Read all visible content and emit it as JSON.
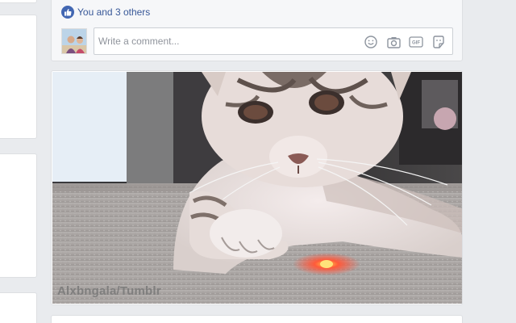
{
  "post": {
    "likes_text": "You and 3 others",
    "like_icon": "thumbs-up-icon"
  },
  "comment": {
    "placeholder": "Write a comment...",
    "icons": [
      "emoji-icon",
      "camera-icon",
      "gif-icon",
      "sticker-icon"
    ],
    "gif_label": "GIF"
  },
  "media": {
    "watermark": "Alxbngala/Tumblr"
  },
  "colors": {
    "page_bg": "#e9ebee",
    "link_blue": "#385898",
    "like_blue": "#4267b2",
    "laser_red": "#ff3b2f"
  }
}
